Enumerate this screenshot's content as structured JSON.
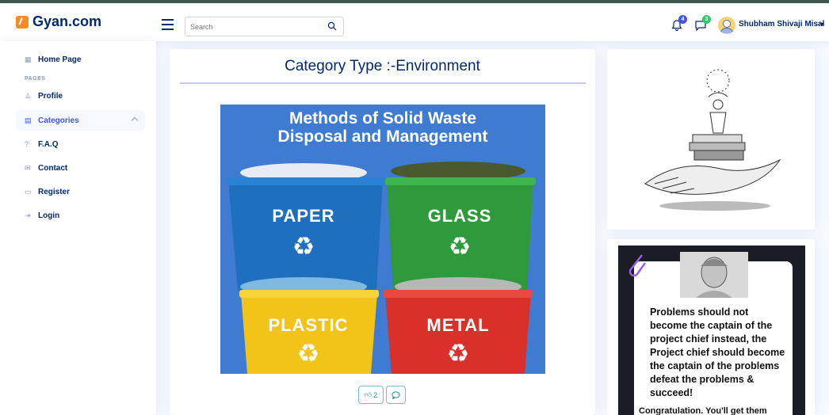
{
  "app": {
    "brand": "Gyan.com"
  },
  "header": {
    "search_placeholder": "Search",
    "notifications_count": "4",
    "messages_count": "3",
    "user_name": "Shubham Shivaji Misal"
  },
  "sidebar": {
    "pages_heading": "PAGES",
    "items": [
      {
        "label": "Home Page",
        "icon": "grid-icon"
      },
      {
        "label": "Profile",
        "icon": "person-icon"
      },
      {
        "label": "Categories",
        "icon": "journal-icon",
        "active": true
      },
      {
        "label": "F.A.Q",
        "icon": "question-icon"
      },
      {
        "label": "Contact",
        "icon": "envelope-icon"
      },
      {
        "label": "Register",
        "icon": "card-icon"
      },
      {
        "label": "Login",
        "icon": "login-icon"
      }
    ]
  },
  "main": {
    "title": "Category Type :-Environment",
    "image": {
      "headline_line1": "Methods of Solid Waste",
      "headline_line2": "Disposal and Management",
      "bins": [
        "PAPER",
        "GLASS",
        "PLASTIC",
        "METAL"
      ]
    },
    "likes": "2"
  },
  "side": {
    "quote": "Problems should not become the captain of the project chief instead, the Project chief should become the captain of the problems defeat the problems & succeed!",
    "quote_more": "Congratulation. You'll get them"
  },
  "colors": {
    "accent": "#4154f1",
    "brand": "#012970",
    "image_bg": "#3f7bd0"
  }
}
